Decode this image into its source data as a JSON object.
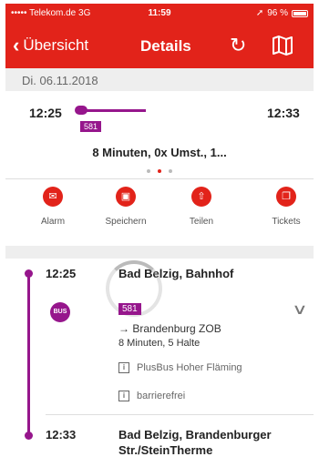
{
  "status_bar": {
    "carrier": "••••• Telekom.de  3G",
    "time": "11:59",
    "battery": "96 %"
  },
  "navbar": {
    "back_label": "Übersicht",
    "title": "Details",
    "refresh_icon": "↻"
  },
  "date": "Di. 06.11.2018",
  "summary": {
    "departure": "12:25",
    "arrival": "12:33",
    "line": "581",
    "text": "8 Minuten, 0x Umst., 1..."
  },
  "actions": [
    {
      "label": "Alarm",
      "icon": "alarm-icon",
      "glyph": "✉"
    },
    {
      "label": "Speichern",
      "icon": "briefcase-icon",
      "glyph": "▣"
    },
    {
      "label": "Teilen",
      "icon": "share-icon",
      "glyph": "⇧"
    },
    {
      "label": "Tickets",
      "icon": "tickets-icon",
      "glyph": "❐"
    }
  ],
  "journey": {
    "start": {
      "time": "12:25",
      "name": "Bad Belzig, Bahnhof"
    },
    "leg": {
      "badge": "BUS",
      "line": "581",
      "direction": "→ Brandenburg ZOB",
      "duration": "8 Minuten, 5 Halte",
      "info": [
        "PlusBus Hoher Fläming",
        "barrierefrei"
      ],
      "info_icon": "i"
    },
    "end": {
      "time": "12:33",
      "name_line1": "Bad Belzig, Brandenburger",
      "name_line2": "Str./SteinTherme"
    }
  },
  "colors": {
    "accent": "#e2231a",
    "bus": "#96168c"
  }
}
